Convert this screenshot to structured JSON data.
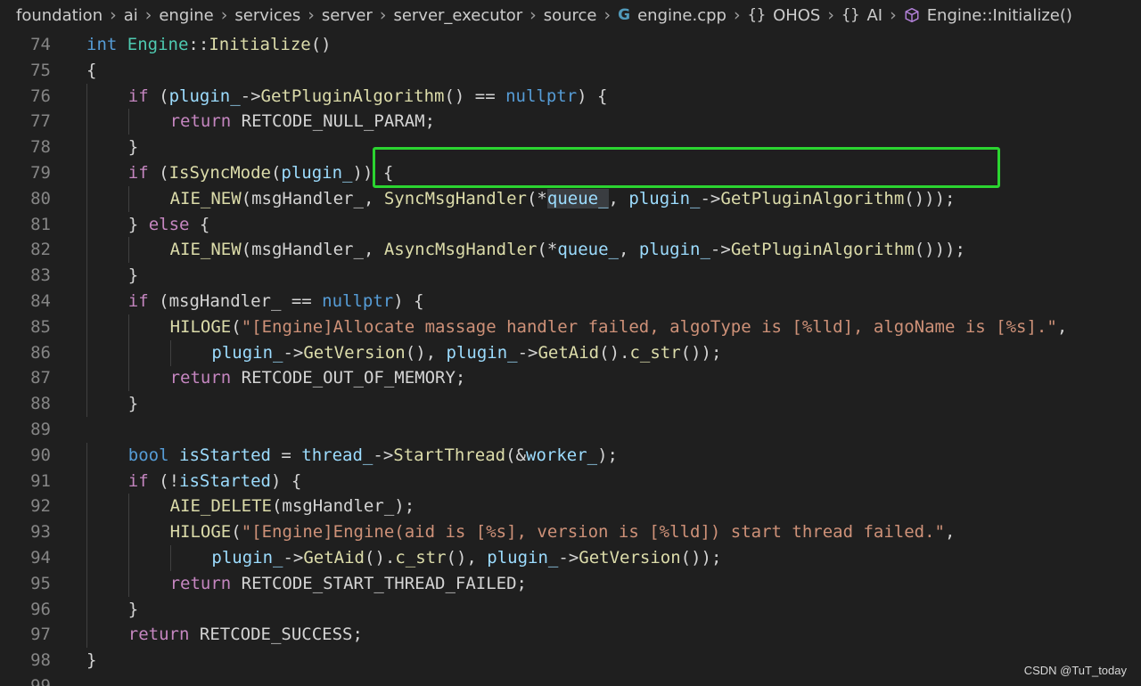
{
  "breadcrumb": [
    {
      "label": "foundation",
      "icon": ""
    },
    {
      "label": "ai",
      "icon": ""
    },
    {
      "label": "engine",
      "icon": ""
    },
    {
      "label": "services",
      "icon": ""
    },
    {
      "label": "server",
      "icon": ""
    },
    {
      "label": "server_executor",
      "icon": ""
    },
    {
      "label": "source",
      "icon": ""
    },
    {
      "label": "engine.cpp",
      "icon": "cpp-file-icon"
    },
    {
      "label": "OHOS",
      "icon": "namespace-icon"
    },
    {
      "label": "AI",
      "icon": "namespace-icon"
    },
    {
      "label": "Engine::Initialize()",
      "icon": "method-icon"
    }
  ],
  "first_line_number": 74,
  "code_lines": [
    {
      "indent": 0,
      "tokens": [
        [
          "int",
          "kw"
        ],
        [
          " ",
          "txt"
        ],
        [
          "Engine",
          "typ"
        ],
        [
          "::",
          "txt"
        ],
        [
          "Initialize",
          "fn"
        ],
        [
          "()",
          "txt"
        ]
      ]
    },
    {
      "indent": 0,
      "tokens": [
        [
          "{",
          "txt"
        ]
      ]
    },
    {
      "indent": 1,
      "tokens": [
        [
          "if",
          "ctl"
        ],
        [
          " (",
          "txt"
        ],
        [
          "plugin_",
          "var"
        ],
        [
          "->",
          "txt"
        ],
        [
          "GetPluginAlgorithm",
          "fn"
        ],
        [
          "() == ",
          "txt"
        ],
        [
          "nullptr",
          "kw"
        ],
        [
          ") {",
          "txt"
        ]
      ]
    },
    {
      "indent": 2,
      "tokens": [
        [
          "return",
          "ctl"
        ],
        [
          " RETCODE_NULL_PARAM;",
          "txt"
        ]
      ]
    },
    {
      "indent": 1,
      "tokens": [
        [
          "}",
          "txt"
        ]
      ]
    },
    {
      "indent": 1,
      "tokens": [
        [
          "if",
          "ctl"
        ],
        [
          " (",
          "txt"
        ],
        [
          "IsSyncMode",
          "fn"
        ],
        [
          "(",
          "txt"
        ],
        [
          "plugin_",
          "var"
        ],
        [
          ")) {",
          "txt"
        ]
      ]
    },
    {
      "indent": 2,
      "tokens": [
        [
          "AIE_NEW",
          "mac"
        ],
        [
          "(msgHandler_, ",
          "txt"
        ],
        [
          "SyncMsgHandler",
          "fn"
        ],
        [
          "(*",
          "txt"
        ],
        [
          "queue_",
          "var hl"
        ],
        [
          ", ",
          "txt"
        ],
        [
          "plugin_",
          "var"
        ],
        [
          "->",
          "txt"
        ],
        [
          "GetPluginAlgorithm",
          "fn"
        ],
        [
          "()));",
          "txt"
        ]
      ]
    },
    {
      "indent": 1,
      "tokens": [
        [
          "} ",
          "txt"
        ],
        [
          "else",
          "ctl"
        ],
        [
          " {",
          "txt"
        ]
      ]
    },
    {
      "indent": 2,
      "tokens": [
        [
          "AIE_NEW",
          "mac"
        ],
        [
          "(msgHandler_, ",
          "txt"
        ],
        [
          "AsyncMsgHandler",
          "fn"
        ],
        [
          "(*",
          "txt"
        ],
        [
          "queue_",
          "var"
        ],
        [
          ", ",
          "txt"
        ],
        [
          "plugin_",
          "var"
        ],
        [
          "->",
          "txt"
        ],
        [
          "GetPluginAlgorithm",
          "fn"
        ],
        [
          "()));",
          "txt"
        ]
      ]
    },
    {
      "indent": 1,
      "tokens": [
        [
          "}",
          "txt"
        ]
      ]
    },
    {
      "indent": 1,
      "tokens": [
        [
          "if",
          "ctl"
        ],
        [
          " (msgHandler_ == ",
          "txt"
        ],
        [
          "nullptr",
          "kw"
        ],
        [
          ") {",
          "txt"
        ]
      ]
    },
    {
      "indent": 2,
      "tokens": [
        [
          "HILOGE",
          "mac"
        ],
        [
          "(",
          "txt"
        ],
        [
          "\"[Engine]Allocate massage handler failed, algoType is [%lld], algoName is [%s].\"",
          "str"
        ],
        [
          ",",
          "txt"
        ]
      ]
    },
    {
      "indent": 3,
      "tokens": [
        [
          "plugin_",
          "var"
        ],
        [
          "->",
          "txt"
        ],
        [
          "GetVersion",
          "fn"
        ],
        [
          "(), ",
          "txt"
        ],
        [
          "plugin_",
          "var"
        ],
        [
          "->",
          "txt"
        ],
        [
          "GetAid",
          "fn"
        ],
        [
          "().",
          "txt"
        ],
        [
          "c_str",
          "fn"
        ],
        [
          "());",
          "txt"
        ]
      ]
    },
    {
      "indent": 2,
      "tokens": [
        [
          "return",
          "ctl"
        ],
        [
          " RETCODE_OUT_OF_MEMORY;",
          "txt"
        ]
      ]
    },
    {
      "indent": 1,
      "tokens": [
        [
          "}",
          "txt"
        ]
      ]
    },
    {
      "indent": 0,
      "tokens": []
    },
    {
      "indent": 1,
      "tokens": [
        [
          "bool",
          "kw"
        ],
        [
          " ",
          "txt"
        ],
        [
          "isStarted",
          "var"
        ],
        [
          " = ",
          "txt"
        ],
        [
          "thread_",
          "var"
        ],
        [
          "->",
          "txt"
        ],
        [
          "StartThread",
          "fn"
        ],
        [
          "(&",
          "txt"
        ],
        [
          "worker_",
          "var"
        ],
        [
          ");",
          "txt"
        ]
      ]
    },
    {
      "indent": 1,
      "tokens": [
        [
          "if",
          "ctl"
        ],
        [
          " (!",
          "txt"
        ],
        [
          "isStarted",
          "var"
        ],
        [
          ") {",
          "txt"
        ]
      ]
    },
    {
      "indent": 2,
      "tokens": [
        [
          "AIE_DELETE",
          "mac"
        ],
        [
          "(msgHandler_);",
          "txt"
        ]
      ]
    },
    {
      "indent": 2,
      "tokens": [
        [
          "HILOGE",
          "mac"
        ],
        [
          "(",
          "txt"
        ],
        [
          "\"[Engine]Engine(aid is [%s], version is [%lld]) start thread failed.\"",
          "str"
        ],
        [
          ",",
          "txt"
        ]
      ]
    },
    {
      "indent": 3,
      "tokens": [
        [
          "plugin_",
          "var"
        ],
        [
          "->",
          "txt"
        ],
        [
          "GetAid",
          "fn"
        ],
        [
          "().",
          "txt"
        ],
        [
          "c_str",
          "fn"
        ],
        [
          "(), ",
          "txt"
        ],
        [
          "plugin_",
          "var"
        ],
        [
          "->",
          "txt"
        ],
        [
          "GetVersion",
          "fn"
        ],
        [
          "());",
          "txt"
        ]
      ]
    },
    {
      "indent": 2,
      "tokens": [
        [
          "return",
          "ctl"
        ],
        [
          " RETCODE_START_THREAD_FAILED;",
          "txt"
        ]
      ]
    },
    {
      "indent": 1,
      "tokens": [
        [
          "}",
          "txt"
        ]
      ]
    },
    {
      "indent": 1,
      "tokens": [
        [
          "return",
          "ctl"
        ],
        [
          " RETCODE_SUCCESS;",
          "txt"
        ]
      ]
    },
    {
      "indent": 0,
      "tokens": [
        [
          "}",
          "txt"
        ]
      ]
    },
    {
      "indent": 0,
      "tokens": []
    }
  ],
  "watermark": "CSDN @TuT_today",
  "colors": {
    "background": "#1f1f1f",
    "line_number": "#858585",
    "highlight_box": "#2bd430",
    "keyword": "#569cd6",
    "control": "#c586c0",
    "function": "#dcdcaa",
    "variable": "#9cdcfe",
    "type": "#4ec9b0",
    "string": "#ce9178"
  }
}
